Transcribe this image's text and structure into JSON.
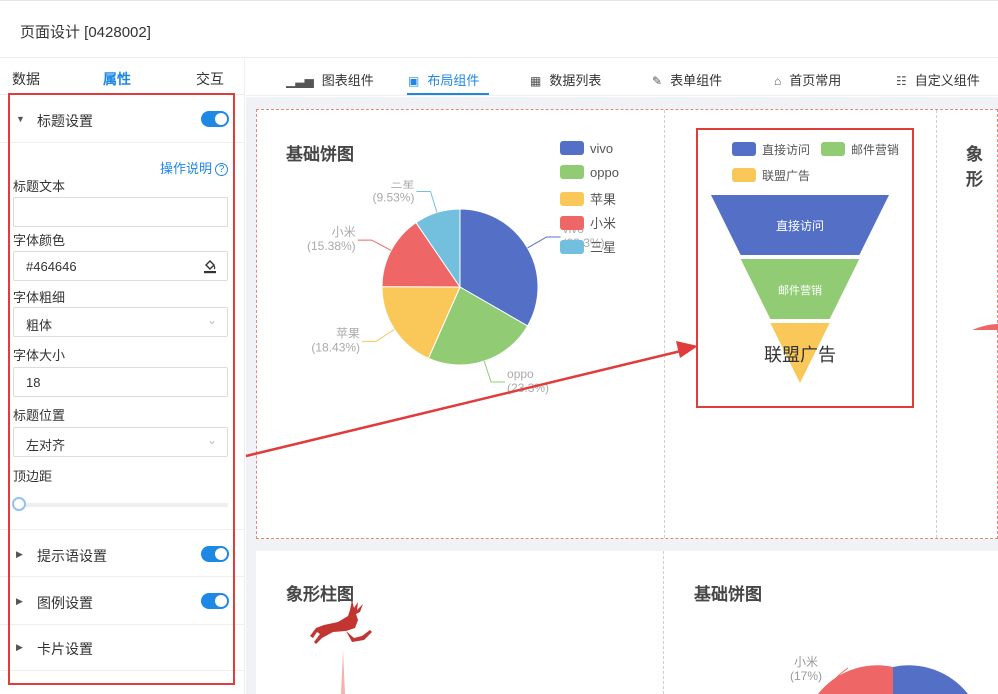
{
  "header": {
    "title": "页面设计 [0428002]"
  },
  "panel": {
    "tabs": [
      "数据",
      "属性",
      "交互"
    ],
    "title_section": {
      "label": "标题设置",
      "enabled": true
    },
    "help_link": "操作说明",
    "fields": {
      "title_text_label": "标题文本",
      "title_text_value": "",
      "font_color_label": "字体颜色",
      "font_color_value": "#464646",
      "font_weight_label": "字体粗细",
      "font_weight_value": "粗体",
      "font_size_label": "字体大小",
      "font_size_value": "18",
      "title_position_label": "标题位置",
      "title_position_value": "左对齐",
      "top_margin_label": "顶边距",
      "top_margin_value": 0
    },
    "sections": [
      {
        "label": "提示语设置",
        "enabled": true
      },
      {
        "label": "图例设置",
        "enabled": true
      },
      {
        "label": "卡片设置"
      }
    ]
  },
  "component_tabs": [
    {
      "label": "图表组件",
      "icon": "bar-chart-icon"
    },
    {
      "label": "布局组件",
      "icon": "layout-icon",
      "active": true
    },
    {
      "label": "数据列表",
      "icon": "table-icon"
    },
    {
      "label": "表单组件",
      "icon": "edit-icon"
    },
    {
      "label": "首页常用",
      "icon": "home-icon"
    },
    {
      "label": "自定义组件",
      "icon": "custom-doc-icon"
    }
  ],
  "canvas": {
    "pie1": {
      "title": "基础饼图"
    },
    "funnel_panel": {},
    "partial_title_right": "象形",
    "pictorial": {
      "title": "象形柱图"
    },
    "pie2": {
      "title": "基础饼图",
      "visible_label": "小米",
      "visible_pct": "(17%)"
    }
  },
  "chart_data": [
    {
      "type": "pie",
      "title": "基础饼图",
      "categories": [
        "vivo",
        "oppo",
        "苹果",
        "小米",
        "三星"
      ],
      "values": [
        33.3,
        23.3,
        18.43,
        15.38,
        9.53
      ],
      "labels": [
        "(33.3%)",
        "(23.3%)",
        "(18.43%)",
        "(15.38%)",
        "(9.53%)"
      ],
      "colors": [
        "#5470c6",
        "#91cc75",
        "#fac858",
        "#ee6666",
        "#73c0de"
      ],
      "legend": "top-right"
    },
    {
      "type": "funnel",
      "categories": [
        "直接访问",
        "邮件营销",
        "联盟广告"
      ],
      "colors": [
        "#5470c6",
        "#91cc75",
        "#fac858"
      ],
      "legend": "top"
    }
  ]
}
